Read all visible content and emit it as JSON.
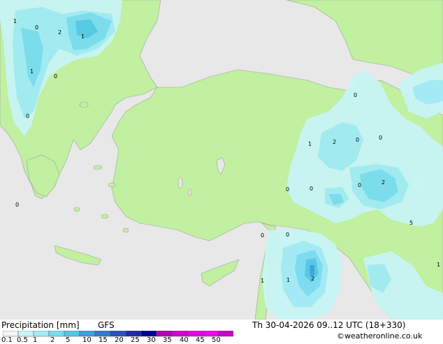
{
  "footer": {
    "title": "Precipitation [mm]",
    "model": "GFS",
    "valid_time": "Th 30-04-2026 09..12 UTC (18+330)",
    "credit": "©weatheronline.co.uk"
  },
  "legend": {
    "tick_labels": [
      "0.1",
      "0.5",
      "1",
      "2",
      "5",
      "10",
      "15",
      "20",
      "25",
      "30",
      "35",
      "40",
      "45",
      "50"
    ],
    "colors": [
      "#f5f5f5",
      "#c8f5f5",
      "#a0ebf5",
      "#78dcf0",
      "#50c8e6",
      "#3ca0dc",
      "#3278d2",
      "#2850be",
      "#1e28aa",
      "#000096",
      "#b400b4",
      "#d200d2",
      "#e600e6",
      "#f000f0",
      "#c800c8"
    ]
  },
  "map_labels": [
    {
      "text": "1"
    },
    {
      "text": "0"
    },
    {
      "text": "2"
    },
    {
      "text": "1"
    },
    {
      "text": "1"
    },
    {
      "text": "0"
    },
    {
      "text": "0"
    },
    {
      "text": "0"
    },
    {
      "text": "0"
    },
    {
      "text": "1"
    },
    {
      "text": "2"
    },
    {
      "text": "0"
    },
    {
      "text": "0"
    },
    {
      "text": "0"
    },
    {
      "text": "0"
    },
    {
      "text": "0"
    },
    {
      "text": "2"
    },
    {
      "text": "0"
    },
    {
      "text": "0"
    },
    {
      "text": "1"
    },
    {
      "text": "1"
    },
    {
      "text": "2"
    },
    {
      "text": "5"
    },
    {
      "text": "1"
    }
  ],
  "colors": {
    "sea": "#e8e8e8",
    "land": "#c0f0a0",
    "coast": "#a0a0a0",
    "precip_light": "#c8f5f5",
    "precip_mid": "#a0ebf5",
    "precip_strong": "#78dcf0",
    "precip_heavy": "#50c8e6",
    "precip_core": "#3ca0dc"
  }
}
